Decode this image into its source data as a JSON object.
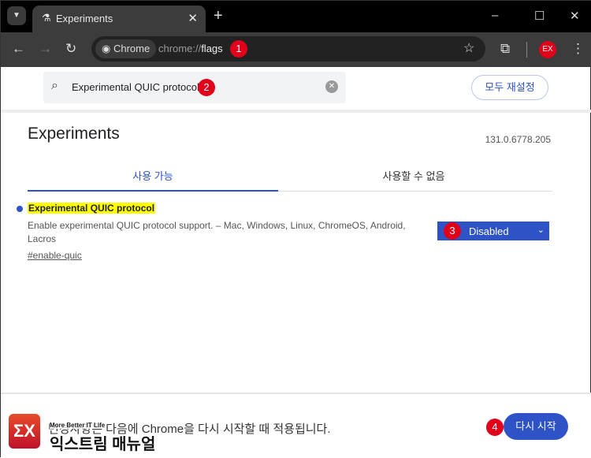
{
  "browser": {
    "tab_title": "Experiments",
    "address_chip": "Chrome",
    "url_prefix": "chrome://",
    "url_path": "flags"
  },
  "search": {
    "value": "Experimental QUIC protocol"
  },
  "reset_button": "모두 재설정",
  "page": {
    "title": "Experiments",
    "version": "131.0.6778.205",
    "tabs": [
      {
        "label": "사용 가능",
        "active": true
      },
      {
        "label": "사용할 수 없음",
        "active": false
      }
    ]
  },
  "flag": {
    "title": "Experimental QUIC protocol",
    "description": "Enable experimental QUIC protocol support. – Mac, Windows, Linux, ChromeOS, Android, Lacros",
    "link": "#enable-quic",
    "selected": "Disabled"
  },
  "footer": {
    "message": "변경사항은 다음에 Chrome을 다시 시작할 때 적용됩니다.",
    "relaunch": "다시 시작"
  },
  "annotations": [
    "1",
    "2",
    "3",
    "4"
  ],
  "watermark": {
    "tagline": "More Better IT Life",
    "name": "익스트림 매뉴얼",
    "mark": "EX"
  },
  "colors": {
    "accent": "#2d53c7",
    "badge": "#e0001b",
    "highlight": "#ffff00"
  }
}
